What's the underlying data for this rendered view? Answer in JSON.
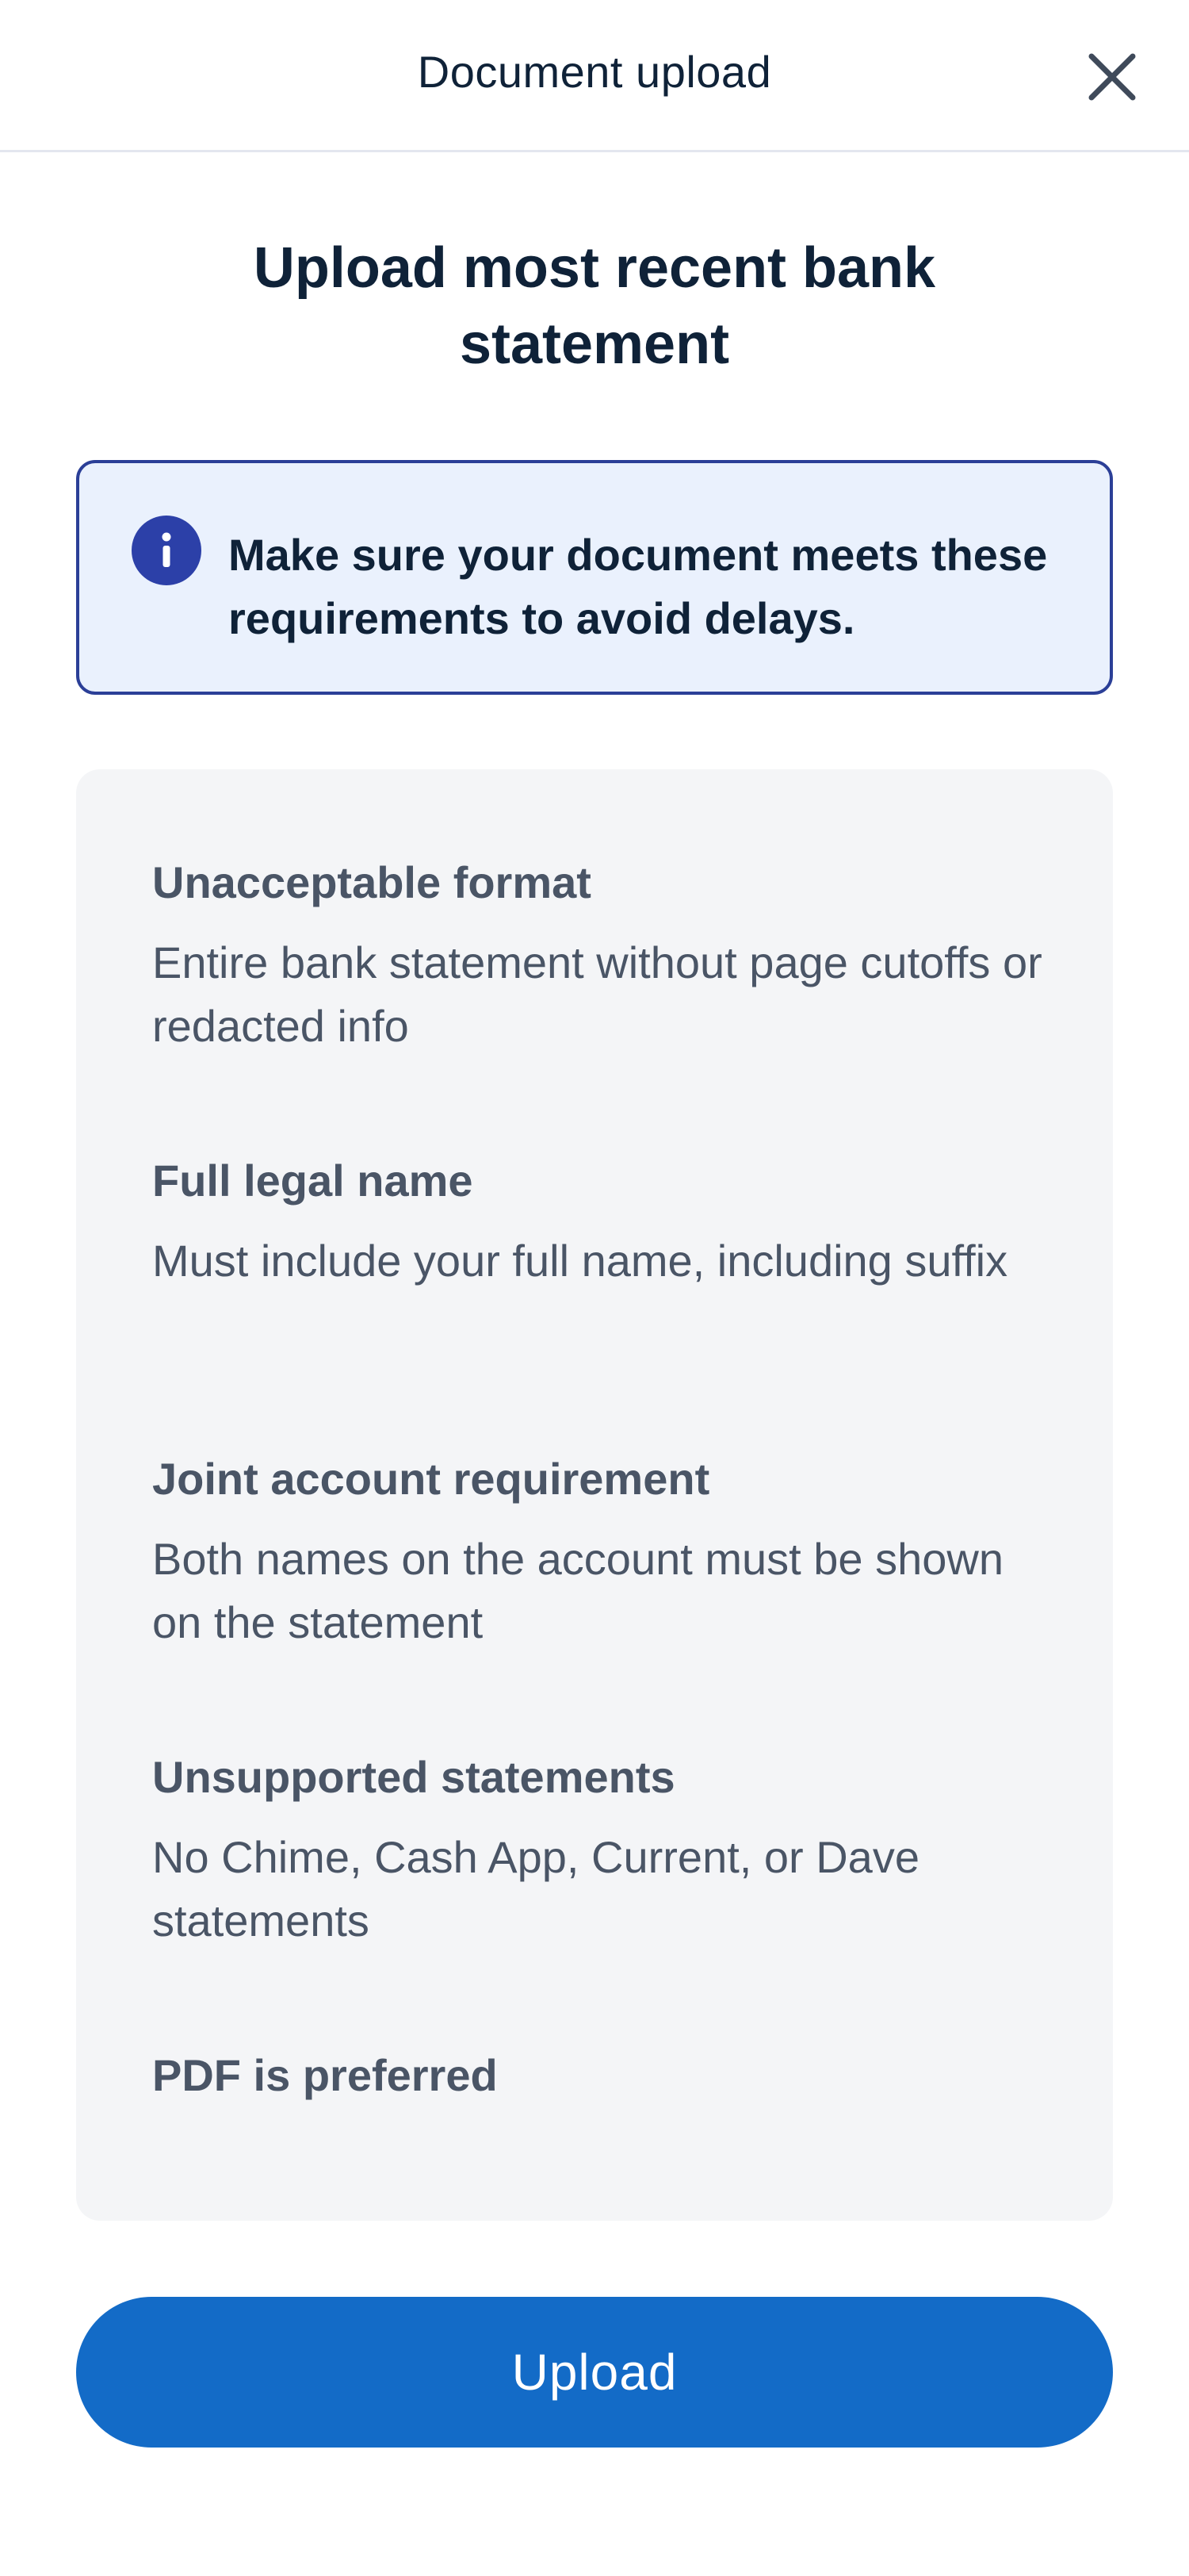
{
  "header": {
    "title": "Document upload",
    "close_icon": "close-icon"
  },
  "main": {
    "title": "Upload most recent bank statement"
  },
  "notice": {
    "icon": "info-icon",
    "text": "Make sure your document meets these requirements to avoid delays.",
    "colors": {
      "background": "#eaf1fd",
      "border": "#2b3f97",
      "icon": "#2c40a8"
    }
  },
  "requirements": [
    {
      "heading": "Unacceptable format",
      "description": "Entire bank statement without page cutoffs or redacted info"
    },
    {
      "heading": "Full legal name",
      "description": "Must include your full name, including suffix"
    },
    {
      "heading": "Joint account requirement",
      "description": "Both names on the account must be shown on the statement"
    },
    {
      "heading": "Unsupported statements",
      "description": "No Chime, Cash App, Current, or Dave statements"
    },
    {
      "heading": "PDF is preferred",
      "description": ""
    }
  ],
  "actions": {
    "upload_label": "Upload",
    "upload_color": "#136bc7"
  }
}
